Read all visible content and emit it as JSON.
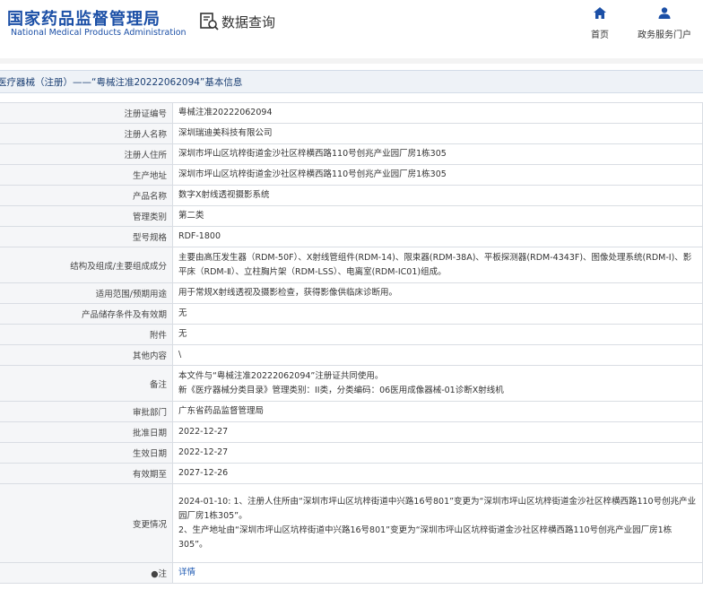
{
  "header": {
    "logo_cn": "国家药品监督管理局",
    "logo_en": "National Medical Products Administration",
    "query_label": "数据查询",
    "nav_home": "首页",
    "nav_gov": "政务服务门户"
  },
  "title": "医疗器械（注册）——“粤械注准20222062094”基本信息",
  "fields": [
    {
      "label": "注册证编号",
      "value": "粤械注准20222062094"
    },
    {
      "label": "注册人名称",
      "value": "深圳瑞迪美科技有限公司"
    },
    {
      "label": "注册人住所",
      "value": "深圳市坪山区坑梓街道金沙社区梓横西路110号创兆产业园厂房1栋305"
    },
    {
      "label": "生产地址",
      "value": "深圳市坪山区坑梓街道金沙社区梓横西路110号创兆产业园厂房1栋305"
    },
    {
      "label": "产品名称",
      "value": "数字X射线透视摄影系统"
    },
    {
      "label": "管理类别",
      "value": "第二类"
    },
    {
      "label": "型号规格",
      "value": "RDF-1800"
    },
    {
      "label": "结构及组成/主要组成成分",
      "value": "主要由高压发生器（RDM-50F）、X射线管组件(RDM-14)、限束器(RDM-38A)、平板探测器(RDM-4343F)、图像处理系统(RDM-I)、影平床（RDM-Ⅱ）、立柱胸片架（RDM-LSS）、电离室(RDM-IC01)组成。"
    },
    {
      "label": "适用范围/预期用途",
      "value": "用于常规X射线透视及摄影检查，获得影像供临床诊断用。"
    },
    {
      "label": "产品储存条件及有效期",
      "value": "无"
    },
    {
      "label": "附件",
      "value": "无"
    },
    {
      "label": "其他内容",
      "value": "\\"
    },
    {
      "label": "备注",
      "value_lines": [
        "本文件与“粤械注准20222062094”注册证共同使用。",
        "新《医疗器械分类目录》管理类别：II类，分类编码：06医用成像器械-01诊断X射线机"
      ]
    },
    {
      "label": "审批部门",
      "value": "广东省药品监督管理局"
    },
    {
      "label": "批准日期",
      "value": "2022-12-27"
    },
    {
      "label": "生效日期",
      "value": "2022-12-27"
    },
    {
      "label": "有效期至",
      "value": "2027-12-26"
    },
    {
      "label": "变更情况",
      "value_lines": [
        "2024-01-10: 1、注册人住所由“深圳市坪山区坑梓街道中兴路16号801”变更为“深圳市坪山区坑梓街道金沙社区梓横西路110号创兆产业园厂房1栋305”。",
        "2、生产地址由“深圳市坪山区坑梓街道中兴路16号801”变更为“深圳市坪山区坑梓街道金沙社区梓横西路110号创兆产业园厂房1栋305”。"
      ]
    },
    {
      "label": "注",
      "label_icon": "●",
      "value": "详情",
      "link": true
    }
  ],
  "colors": {
    "brand": "#1b4fa6",
    "link": "#1e5ab3",
    "label_bg": "#f5f6f8",
    "border": "#d9dde3"
  }
}
